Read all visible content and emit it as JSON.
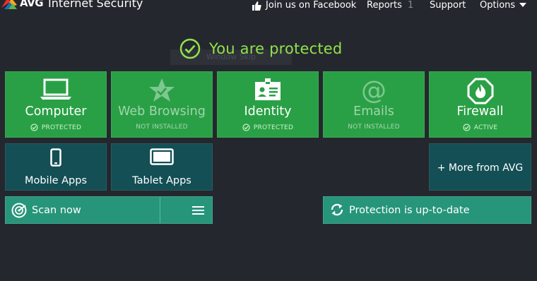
{
  "header": {
    "logo_text": "AVG",
    "product": "Internet Security",
    "facebook": "Join us on Facebook",
    "reports": "Reports",
    "reports_count": "1",
    "support": "Support",
    "options": "Options"
  },
  "status": {
    "text": "You are protected",
    "ghost_tooltip": "Window Skip"
  },
  "tiles": [
    {
      "title": "Computer",
      "status": "PROTECTED"
    },
    {
      "title": "Web Browsing",
      "status": "NOT INSTALLED"
    },
    {
      "title": "Identity",
      "status": "PROTECTED"
    },
    {
      "title": "Emails",
      "status": "NOT INSTALLED"
    },
    {
      "title": "Firewall",
      "status": "ACTIVE"
    }
  ],
  "apps": [
    {
      "title": "Mobile Apps"
    },
    {
      "title": "Tablet Apps"
    }
  ],
  "more": "+ More from AVG",
  "scan": "Scan now",
  "update": "Protection is up-to-date",
  "colors": {
    "background": "#25272e",
    "tile_green": "#2aa046",
    "tile_teal": "#134f55",
    "action_mint": "#26957a",
    "status_green": "#8fe24a"
  }
}
